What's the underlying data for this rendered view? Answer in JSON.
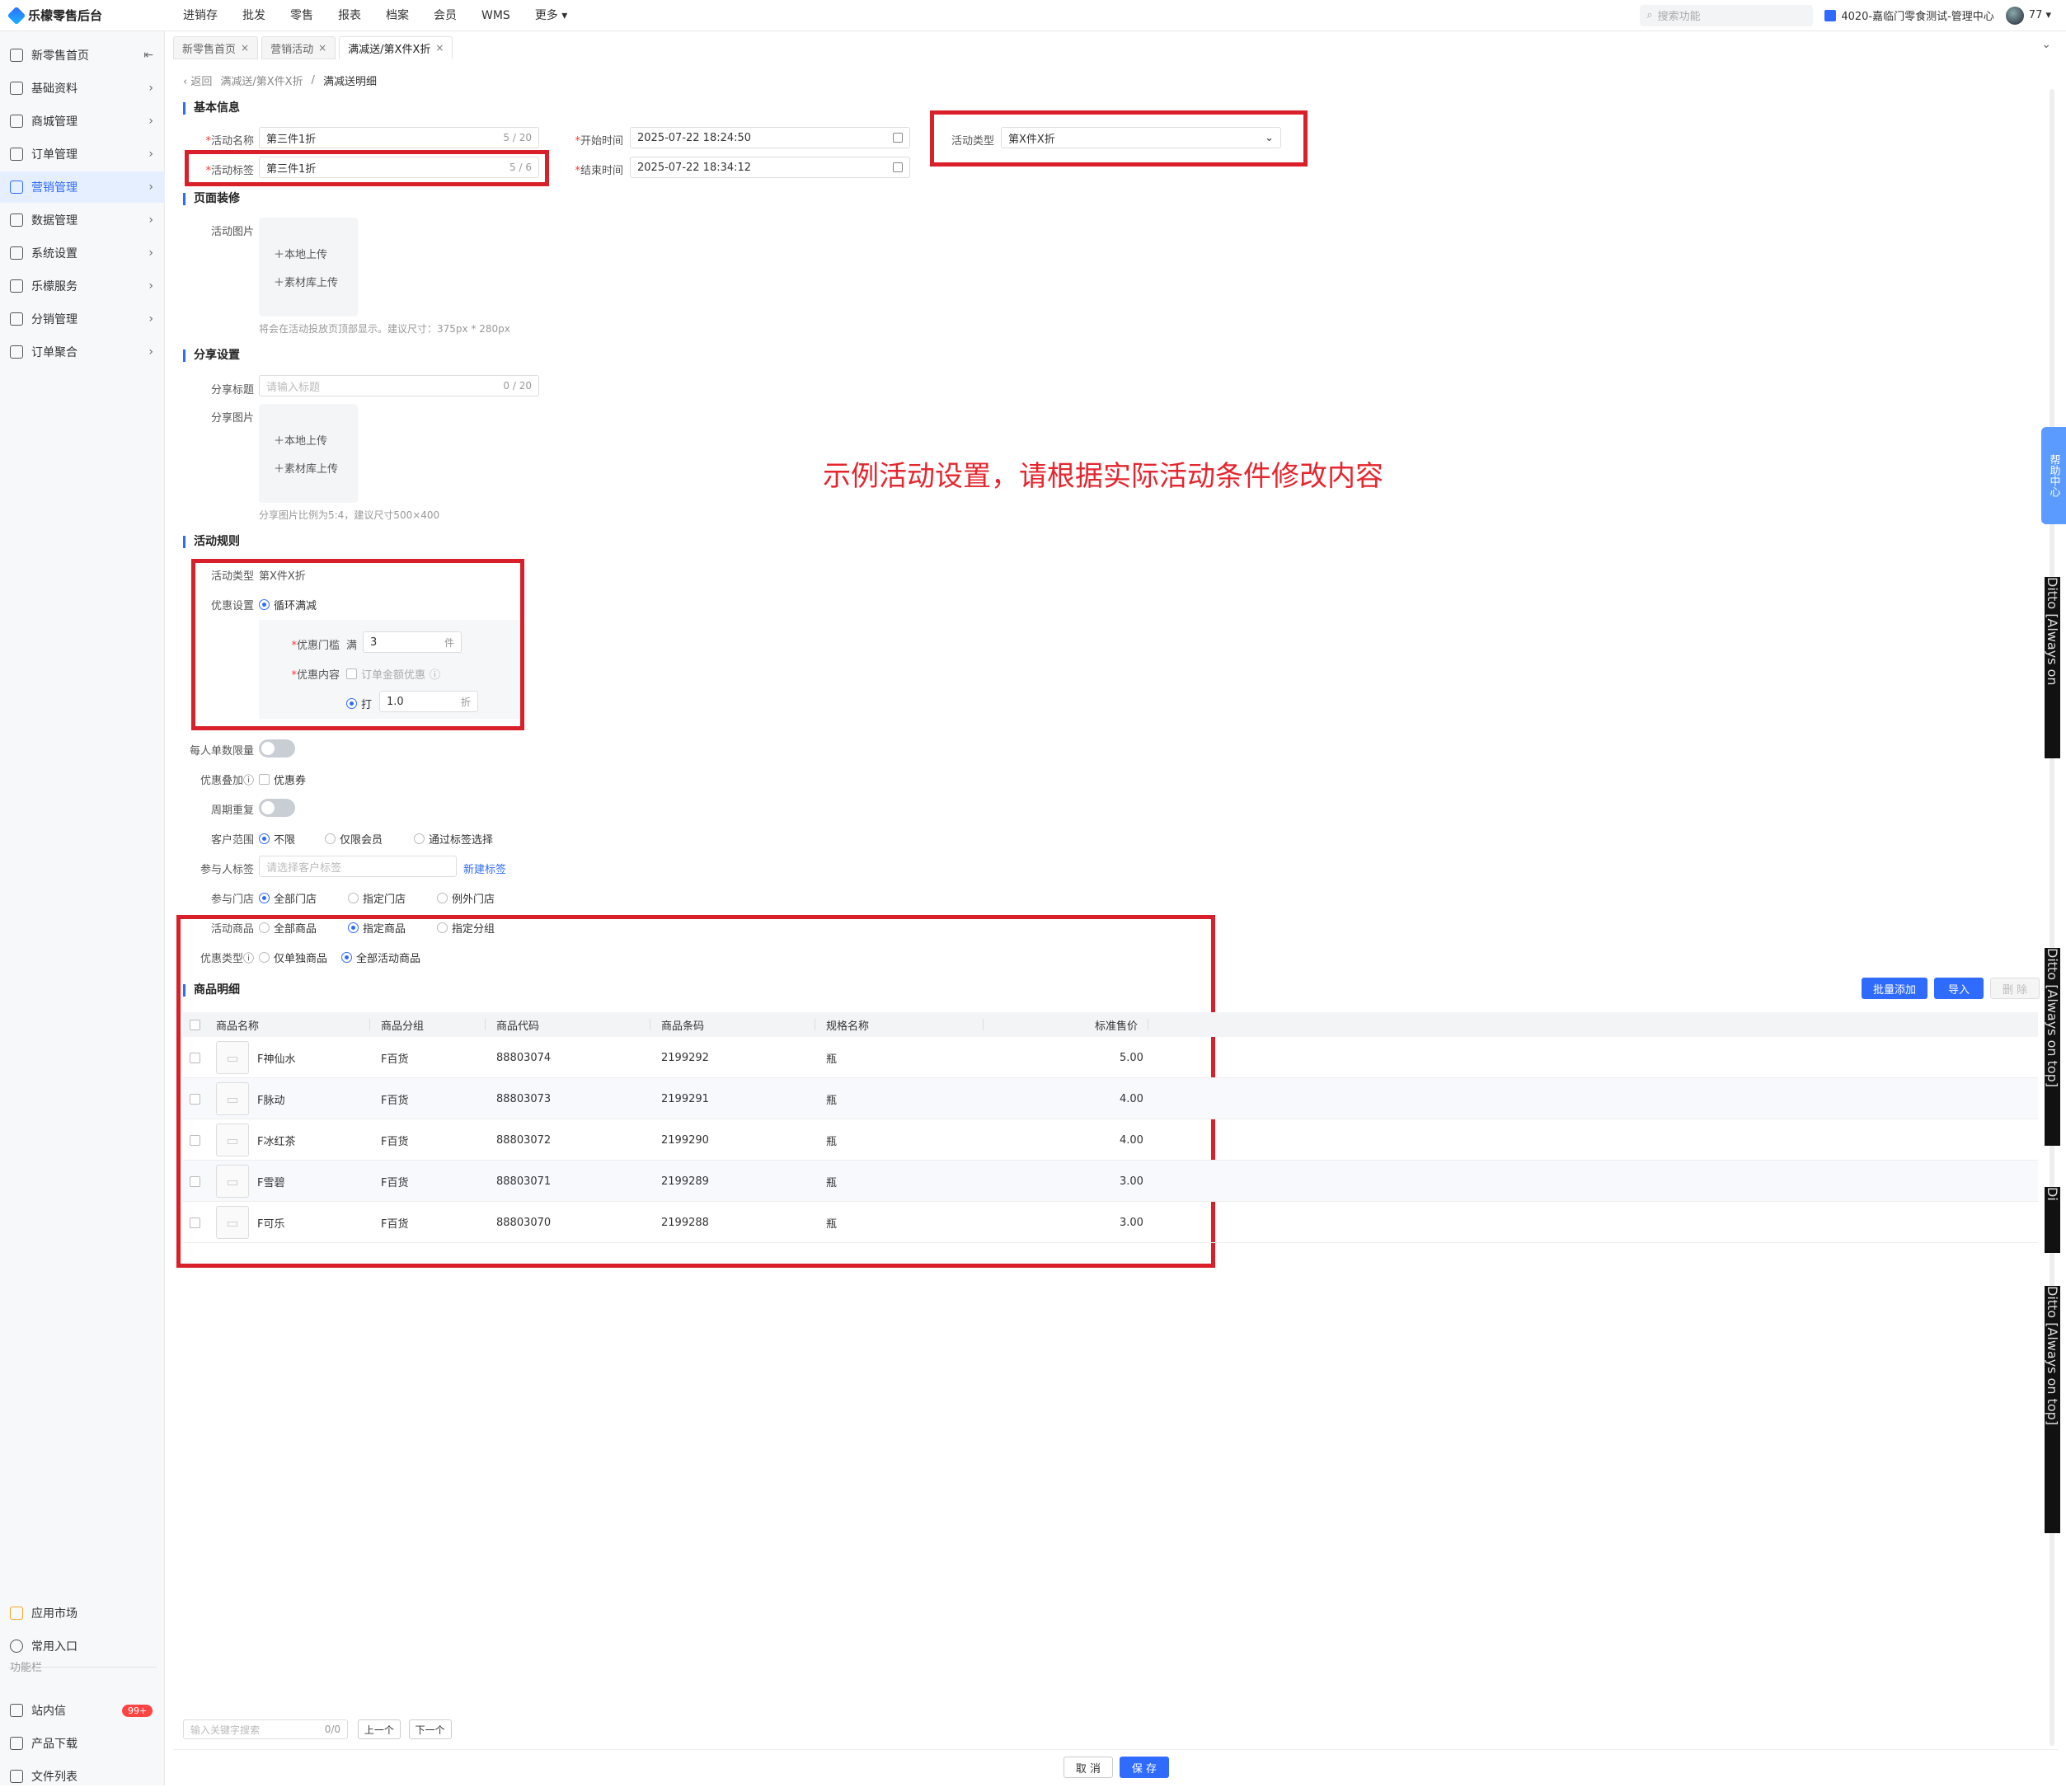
{
  "app": {
    "title": "乐檬零售后台"
  },
  "topnav": [
    "进销存",
    "批发",
    "零售",
    "报表",
    "档案",
    "会员",
    "WMS",
    "更多 ▾"
  ],
  "topright": {
    "search_placeholder": "搜索功能",
    "store": "4020-嘉临门零食测试-管理中心",
    "user": "77 ▾"
  },
  "sidebar": {
    "items": [
      {
        "label": "新零售首页",
        "extra": "⇤"
      },
      {
        "label": "基础资料",
        "extra": "›"
      },
      {
        "label": "商城管理",
        "extra": "›"
      },
      {
        "label": "订单管理",
        "extra": "›"
      },
      {
        "label": "营销管理",
        "extra": "›"
      },
      {
        "label": "数据管理",
        "extra": "›"
      },
      {
        "label": "系统设置",
        "extra": "›"
      },
      {
        "label": "乐檬服务",
        "extra": "›"
      },
      {
        "label": "分销管理",
        "extra": "›"
      },
      {
        "label": "订单聚合",
        "extra": "›"
      }
    ],
    "bottom": {
      "app_market": "应用市场",
      "common": "常用入口",
      "caption": "功能栏",
      "inbox": "站内信",
      "inbox_badge": "99+",
      "download": "产品下载",
      "files": "文件列表"
    }
  },
  "tabs": [
    {
      "label": "新零售首页",
      "close": "×"
    },
    {
      "label": "营销活动",
      "close": "×"
    },
    {
      "label": "满减送/第X件X折",
      "close": "×"
    }
  ],
  "breadcrumb": {
    "back": "‹  返回",
    "parent": "满减送/第X件X折",
    "sep": "/",
    "current": "满减送明细"
  },
  "basic": {
    "title": "基本信息",
    "name_label": "活动名称",
    "name_value": "第三件1折",
    "name_count": "5 / 20",
    "tag_label": "活动标签",
    "tag_value": "第三件1折",
    "tag_count": "5 / 6",
    "start_label": "开始时间",
    "start_value": "2025-07-22 18:24:50",
    "end_label": "结束时间",
    "end_value": "2025-07-22 18:34:12",
    "type_label": "活动类型",
    "type_value": "第X件X折"
  },
  "decor": {
    "title": "页面装修",
    "image_label": "活动图片",
    "upload_local": "＋本地上传",
    "upload_lib": "＋素材库上传",
    "hint": "将会在活动投放页顶部显示。建议尺寸：375px * 280px"
  },
  "share": {
    "title": "分享设置",
    "title_label": "分享标题",
    "title_placeholder": "请输入标题",
    "title_count": "0 / 20",
    "image_label": "分享图片",
    "upload_local": "＋本地上传",
    "upload_lib": "＋素材库上传",
    "hint": "分享图片比例为5:4，建议尺寸500×400"
  },
  "note": "示例活动设置，请根据实际活动条件修改内容",
  "rules": {
    "title": "活动规则",
    "type_label": "活动类型",
    "type_value": "第X件X折",
    "discount_label": "优惠设置",
    "discount_option": "循环满减",
    "threshold_label": "优惠门槛",
    "threshold_prefix": "满",
    "threshold_value": "3",
    "threshold_unit": "件",
    "content_label": "优惠内容",
    "content_check": "订单金额优惠",
    "rate_prefix": "打",
    "rate_value": "1.0",
    "rate_unit": "折",
    "limit_label": "每人单数限量",
    "stack_label": "优惠叠加",
    "stack_option": "优惠券",
    "cycle_label": "周期重复",
    "customer_label": "客户范围",
    "customer_options": [
      "不限",
      "仅限会员",
      "通过标签选择"
    ],
    "tag_label": "参与人标签",
    "tag_placeholder": "请选择客户标签",
    "tag_new": "新建标签",
    "store_label": "参与门店",
    "store_options": [
      "全部门店",
      "指定门店",
      "例外门店"
    ],
    "goods_label": "活动商品",
    "goods_options": [
      "全部商品",
      "指定商品",
      "指定分组"
    ],
    "promo_label": "优惠类型",
    "promo_options": [
      "仅单独商品",
      "全部活动商品"
    ]
  },
  "detail": {
    "title": "商品明细",
    "buttons": {
      "batch": "批量添加",
      "import": "导入",
      "delete": "删 除"
    },
    "columns": [
      "商品名称",
      "商品分组",
      "商品代码",
      "商品条码",
      "规格名称",
      "标准售价"
    ],
    "rows": [
      {
        "name": "F神仙水",
        "group": "F百货",
        "code": "88803074",
        "barcode": "2199292",
        "spec": "瓶",
        "price": "5.00"
      },
      {
        "name": "F脉动",
        "group": "F百货",
        "code": "88803073",
        "barcode": "2199291",
        "spec": "瓶",
        "price": "4.00"
      },
      {
        "name": "F冰红茶",
        "group": "F百货",
        "code": "88803072",
        "barcode": "2199290",
        "spec": "瓶",
        "price": "4.00"
      },
      {
        "name": "F雪碧",
        "group": "F百货",
        "code": "88803071",
        "barcode": "2199289",
        "spec": "瓶",
        "price": "3.00"
      },
      {
        "name": "F可乐",
        "group": "F百货",
        "code": "88803070",
        "barcode": "2199288",
        "spec": "瓶",
        "price": "3.00"
      }
    ]
  },
  "finder": {
    "placeholder": "输入关键字搜索",
    "count": "0/0",
    "prev": "上一个",
    "next": "下一个"
  },
  "footer": {
    "cancel": "取 消",
    "save": "保 存"
  },
  "helper": "帮助中心",
  "ditto": "Ditto [Always on top]",
  "ditto_short": "Ditto [Always on",
  "ditto_tiny": "Di"
}
